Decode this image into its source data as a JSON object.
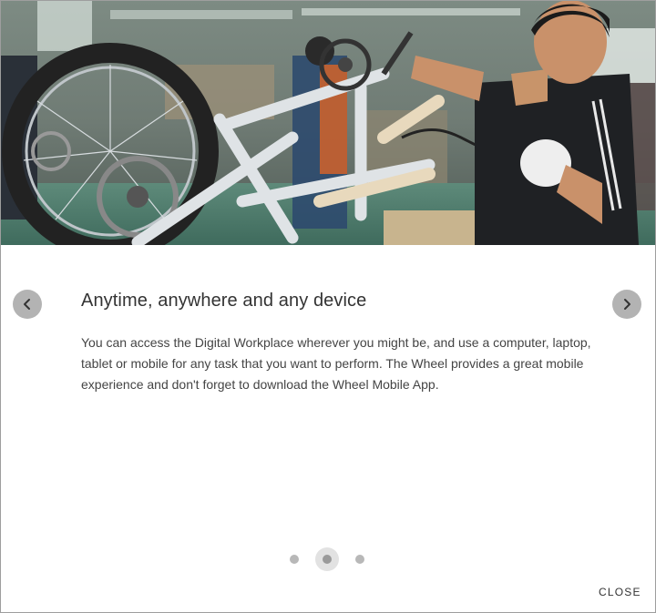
{
  "slide": {
    "title": "Anytime, anywhere and any device",
    "body": "You can access the Digital Workplace wherever you might be, and use a computer, laptop, tablet or mobile for any task that you want to perform. The Wheel provides a great mobile experience and don't forget to download the Wheel Mobile App."
  },
  "carousel": {
    "prev_icon": "chevron-left-icon",
    "next_icon": "chevron-right-icon",
    "dots": 3,
    "active_dot": 2
  },
  "footer": {
    "close_label": "CLOSE"
  },
  "colors": {
    "nav_button": "#b3b3b3",
    "dot": "#b8b8b8",
    "dot_active": "#9a9a9a",
    "title_text": "#333333",
    "body_text": "#444444"
  }
}
